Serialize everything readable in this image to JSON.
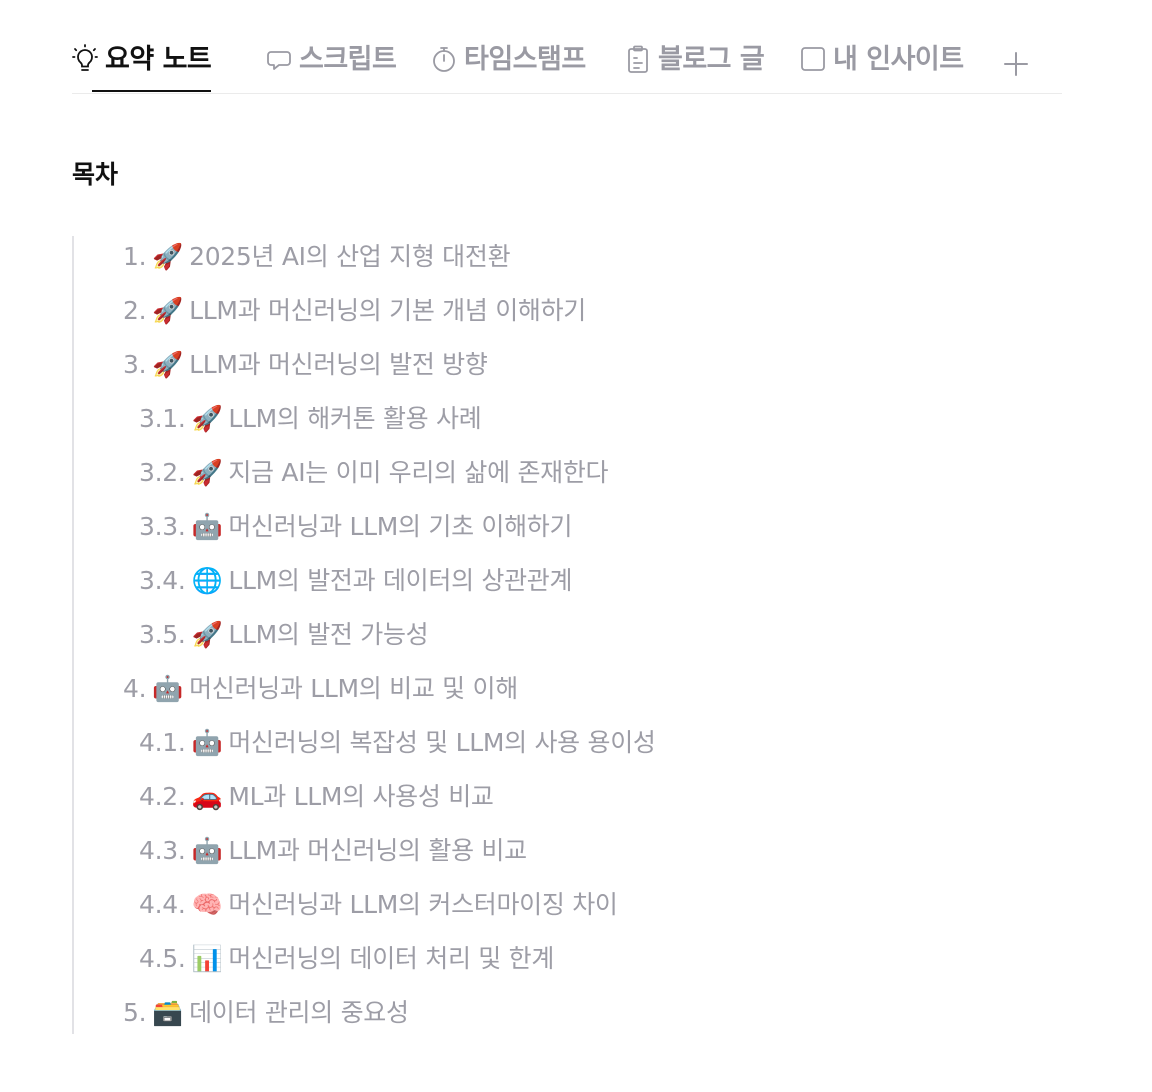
{
  "tabs": [
    {
      "label": "요약 노트",
      "icon": "lightbulb-icon",
      "active": true
    },
    {
      "label": "스크립트",
      "icon": "chat-bubble-icon",
      "active": false
    },
    {
      "label": "타임스탬프",
      "icon": "stopwatch-icon",
      "active": false
    },
    {
      "label": "블로그 글",
      "icon": "clipboard-icon",
      "active": false
    },
    {
      "label": "내 인사이트",
      "icon": "square-icon",
      "active": false
    }
  ],
  "add_tab_icon": "plus-icon",
  "toc": {
    "heading": "목차",
    "items": [
      {
        "number": "1.",
        "emoji": "🚀",
        "title": "2025년 AI의 산업 지형 대전환",
        "level": 1
      },
      {
        "number": "2.",
        "emoji": "🚀",
        "title": "LLM과 머신러닝의 기본 개념 이해하기",
        "level": 1
      },
      {
        "number": "3.",
        "emoji": "🚀",
        "title": "LLM과 머신러닝의 발전 방향",
        "level": 1
      },
      {
        "number": "3.1.",
        "emoji": "🚀",
        "title": "LLM의 해커톤 활용 사례",
        "level": 2
      },
      {
        "number": "3.2.",
        "emoji": "🚀",
        "title": "지금 AI는 이미 우리의 삶에 존재한다",
        "level": 2
      },
      {
        "number": "3.3.",
        "emoji": "🤖",
        "title": "머신러닝과 LLM의 기초 이해하기",
        "level": 2
      },
      {
        "number": "3.4.",
        "emoji": "🌐",
        "title": "LLM의 발전과 데이터의 상관관계",
        "level": 2
      },
      {
        "number": "3.5.",
        "emoji": "🚀",
        "title": "LLM의 발전 가능성",
        "level": 2
      },
      {
        "number": "4.",
        "emoji": "🤖",
        "title": "머신러닝과 LLM의 비교 및 이해",
        "level": 1
      },
      {
        "number": "4.1.",
        "emoji": "🤖",
        "title": "머신러닝의 복잡성 및 LLM의 사용 용이성",
        "level": 2
      },
      {
        "number": "4.2.",
        "emoji": "🚗",
        "title": "ML과 LLM의 사용성 비교",
        "level": 2
      },
      {
        "number": "4.3.",
        "emoji": "🤖",
        "title": "LLM과 머신러닝의 활용 비교",
        "level": 2
      },
      {
        "number": "4.4.",
        "emoji": "🧠",
        "title": "머신러닝과 LLM의 커스터마이징 차이",
        "level": 2
      },
      {
        "number": "4.5.",
        "emoji": "📊",
        "title": "머신러닝의 데이터 처리 및 한계",
        "level": 2
      },
      {
        "number": "5.",
        "emoji": "🗃️",
        "title": "데이터 관리의 중요성",
        "level": 1
      }
    ]
  },
  "colors": {
    "active_tab_text": "#111111",
    "inactive_tab_text": "#9a9aa3",
    "toc_text": "#9d9da6",
    "rail": "#e2e2e6",
    "divider": "#ebebeb"
  }
}
